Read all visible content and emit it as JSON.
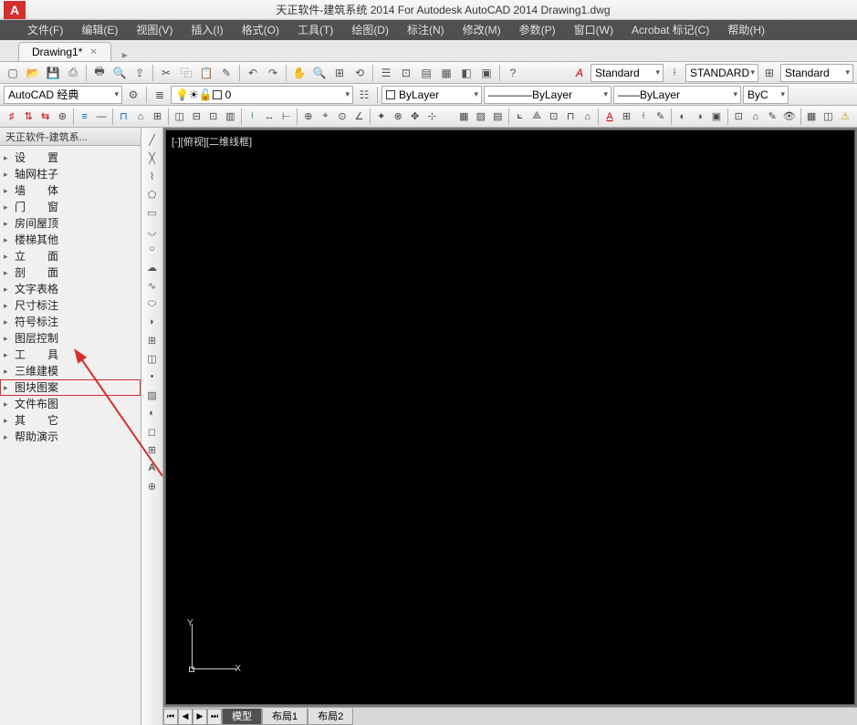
{
  "title": "天正软件-建筑系统 2014  For Autodesk AutoCAD 2014    Drawing1.dwg",
  "menu": [
    "文件(F)",
    "编辑(E)",
    "视图(V)",
    "插入(I)",
    "格式(O)",
    "工具(T)",
    "绘图(D)",
    "标注(N)",
    "修改(M)",
    "参数(P)",
    "窗口(W)",
    "Acrobat 标记(C)",
    "帮助(H)"
  ],
  "docTab": {
    "label": "Drawing1*"
  },
  "workspace": "AutoCAD 经典",
  "styleDropdowns": {
    "a": "Standard",
    "b": "STANDARD",
    "c": "Standard"
  },
  "layerRow": {
    "layer": "0",
    "linetype": "ByLayer",
    "lineweight": "ByLayer",
    "color": "ByLayer",
    "plotstyle": "ByC"
  },
  "sidebar": {
    "title": "天正软件-建筑系...",
    "items": [
      {
        "label": "设　　置",
        "spaced": false
      },
      {
        "label": "轴网柱子"
      },
      {
        "label": "墙　　体"
      },
      {
        "label": "门　　窗"
      },
      {
        "label": "房间屋顶"
      },
      {
        "label": "楼梯其他"
      },
      {
        "label": "立　　面"
      },
      {
        "label": "剖　　面"
      },
      {
        "label": "文字表格"
      },
      {
        "label": "尺寸标注"
      },
      {
        "label": "符号标注"
      },
      {
        "label": "图层控制"
      },
      {
        "label": "工　　具"
      },
      {
        "label": "三维建模"
      },
      {
        "label": "图块图案",
        "hl": true
      },
      {
        "label": "文件布图"
      },
      {
        "label": "其　　它"
      },
      {
        "label": "帮助演示"
      }
    ]
  },
  "viewport": {
    "label": "[-][俯视][二维线框]",
    "y": "Y",
    "x": "X"
  },
  "bottomTabs": {
    "model": "模型",
    "layout1": "布局1",
    "layout2": "布局2"
  }
}
